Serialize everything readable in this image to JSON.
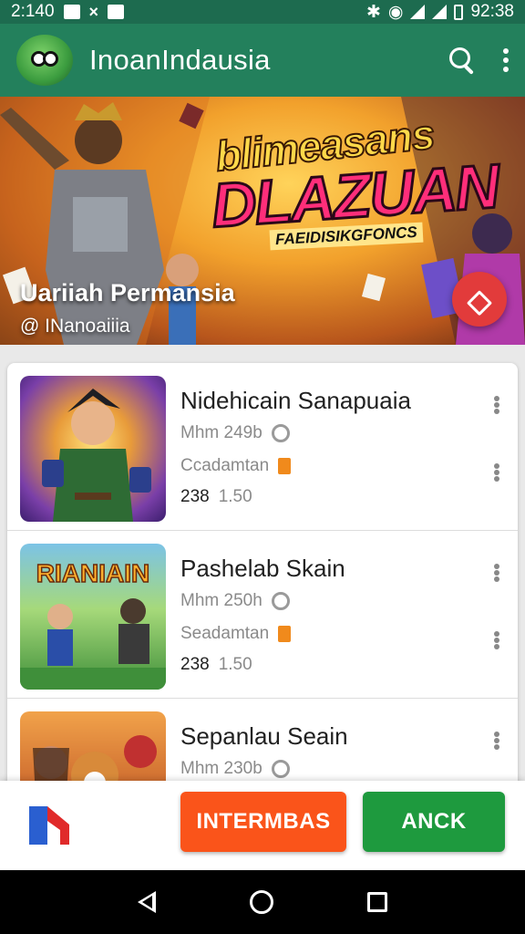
{
  "status_bar": {
    "time_left": "2:140",
    "time_right": "92:38"
  },
  "app_bar": {
    "title": "InoanIndausia"
  },
  "banner": {
    "headline_line1": "blimeasans",
    "headline_line2": "DLAZUAN",
    "tagline": "FAEIDISIKGFONCS",
    "title": "Uariiah Permansia",
    "handle": "@ INanoaiiia"
  },
  "games": [
    {
      "name": "Nidehicain Sanapuaia",
      "size": "Mhm 249b",
      "category": "Ccadamtan",
      "price": "238",
      "rating": "1.50"
    },
    {
      "name": "Pashelab Skain",
      "size": "Mhm 250h",
      "category": "Seadamtan",
      "price": "238",
      "rating": "1.50"
    },
    {
      "name": "Sepanlau Seain",
      "size": "Mhm 230b",
      "category": "",
      "price": "",
      "rating": ""
    }
  ],
  "thumbnail_text": {
    "game2_title": "RIANIAIN"
  },
  "bottom_bar": {
    "primary_button": "INTERMBAS",
    "secondary_button": "ANCK"
  },
  "colors": {
    "app_bar": "#23805c",
    "status_bar": "#1d6b4f",
    "orange_button": "#fa541a",
    "green_button": "#1e9a3e",
    "fab": "#e23b3b"
  },
  "icons": [
    "search-icon",
    "more-vert-icon",
    "heart-icon",
    "back-icon",
    "home-icon",
    "recents-icon"
  ]
}
